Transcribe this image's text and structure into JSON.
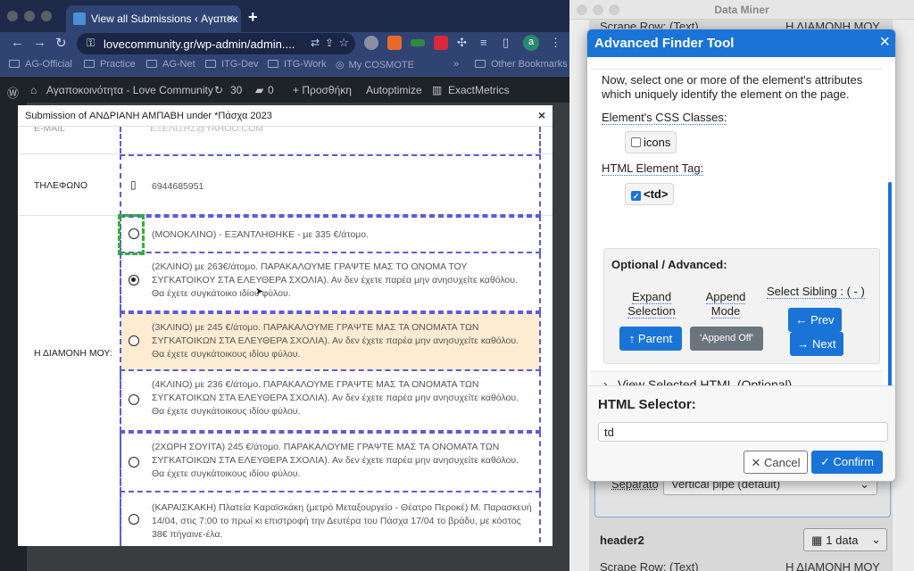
{
  "browser": {
    "tab_title": "View all Submissions ‹ Αγαποκ",
    "url": "lovecommunity.gr/wp-admin/admin....",
    "bookmarks": [
      "AG-Official",
      "Practice",
      "AG-Net",
      "ITG-Dev",
      "ITG-Work",
      "My COSMOTE"
    ],
    "other_bookmarks": "Other Bookmarks",
    "more": "»",
    "profile_initial": "a"
  },
  "wpbar": {
    "site": "Αγαποκοινότητα - Love Community",
    "updates": "30",
    "comments": "0",
    "new": "+ Προσθήκη",
    "autoptimize": "Autoptimize",
    "exactmetrics": "ExactMetrics"
  },
  "modal": {
    "title": "Submission of ΑΝΔΡΙΑΝΗ ΑΜΠΑΒΗ under *Πάσχα 2023",
    "close": "×",
    "top_label": "E-MAIL",
    "top_value": "ΕΞΕΛΙΞΗΣ@YAHOO.COM",
    "phone_label": "ΤΗΛΕΦΩΝΟ",
    "phone_value": "6944685951",
    "stay_label": "Η ΔΙΑΜΟΝΗ ΜΟΥ:",
    "options": [
      "(ΜΟΝΟΚΛΙΝΟ) - ΕΞΑΝΤΛΗΘΗΚΕ - με 335 €/άτομο.",
      "(2ΚΛΙΝΟ) με 263€/άτομο. ΠΑΡΑΚΑΛΟΥΜΕ ΓΡΑΨΤΕ ΜΑΣ ΤΟ ΟΝΟΜΑ ΤΟΥ ΣΥΓΚΑΤΟΙΚΟΥ ΣΤΑ ΕΛΕΥΘΕΡΑ ΣΧΟΛΙΑ). Αν δεν έχετε παρέα μην ανησυχείτε καθόλου. Θα έχετε συγκάτοικο ιδίου φύλου.",
      "(3ΚΛΙΝΟ) με 245 €/άτομο. ΠΑΡΑΚΑΛΟΥΜΕ ΓΡΑΨΤΕ ΜΑΣ ΤΑ ΟΝΟΜΑΤΑ ΤΩΝ ΣΥΓΚΑΤΟΙΚΩΝ ΣΤΑ ΕΛΕΥΘΕΡΑ ΣΧΟΛΙΑ). Αν δεν έχετε παρέα μην ανησυχείτε καθόλου. Θα έχετε συγκάτοικους ιδίου φύλου.",
      "(4ΚΛΙΝΟ) με 236 €/άτομο. ΠΑΡΑΚΑΛΟΥΜΕ ΓΡΑΨΤΕ ΜΑΣ ΤΑ ΟΝΟΜΑΤΑ ΤΩΝ ΣΥΓΚΑΤΟΙΚΩΝ ΣΤΑ ΕΛΕΥΘΕΡΑ ΣΧΟΛΙΑ). Αν δεν έχετε παρέα μην ανησυχείτε καθόλου. Θα έχετε συγκάτοικους ιδίου φύλου.",
      "(2ΧΩΡΗ ΣΟΥΙΤΑ) 245 €/άτομο. ΠΑΡΑΚΑΛΟΥΜΕ ΓΡΑΨΤΕ ΜΑΣ ΤΑ ΟΝΟΜΑΤΑ ΤΩΝ ΣΥΓΚΑΤΟΙΚΩΝ ΣΤΑ ΕΛΕΥΘΕΡΑ ΣΧΟΛΙΑ). Αν δεν έχετε παρέα μην ανησυχείτε καθόλου. Θα έχετε συγκάτοικους ιδίου φύλου.",
      "(ΚΑΡΑΙΣΚΑΚΗ) Πλατεία Καραϊσκάκη (μετρό Μεταξουργείο - Θέατρο Περοκέ) Μ. Παρασκευή 14/04, στις 7:00 το πρωί κι επιστροφή την Δευτέρα του Πάσχα 17/04 το βράδυ, με κόστος 38€ πήγαινε-έλα."
    ]
  },
  "dataminer": {
    "window_title": "Data Miner",
    "bg_scrape_row_top": "Scrape Row: (Text)",
    "bg_scrape_value_top": "Η ΔΙΑΜΟΝΗ ΜΟΥ",
    "bg_separator_label": "Separato",
    "bg_separator_value": "Vertical pipe (default)",
    "bg_header2": "header2",
    "bg_data_button": "1 data",
    "bg_scrape_row_bottom": "Scrape Row: (Text)",
    "bg_scrape_value_bottom": "Η ΔΙΑΜΟΝΗ ΜΟΥ"
  },
  "finder": {
    "title": "Advanced Finder Tool",
    "close": "×",
    "intro": "Now, select one or more of the element's attributes which uniquely identify the element on the page.",
    "css_classes_label": "Element's CSS Classes:",
    "css_class_chip": "icons",
    "tag_label": "HTML Element Tag:",
    "tag_chip": "<td>",
    "advanced_title": "Optional / Advanced:",
    "expand_label": "Expand Selection",
    "append_label": "Append Mode",
    "sibling_label": "Select Sibling : ( - )",
    "parent_button": "↑ Parent",
    "append_button": "'Append Off'",
    "prev_button": "← Prev",
    "next_button": "→ Next",
    "view_html": "View Selected HTML (Optional)",
    "selector_label": "HTML Selector:",
    "selector_value": "td",
    "cancel_button": "✕ Cancel",
    "confirm_button": "✓ Confirm"
  }
}
